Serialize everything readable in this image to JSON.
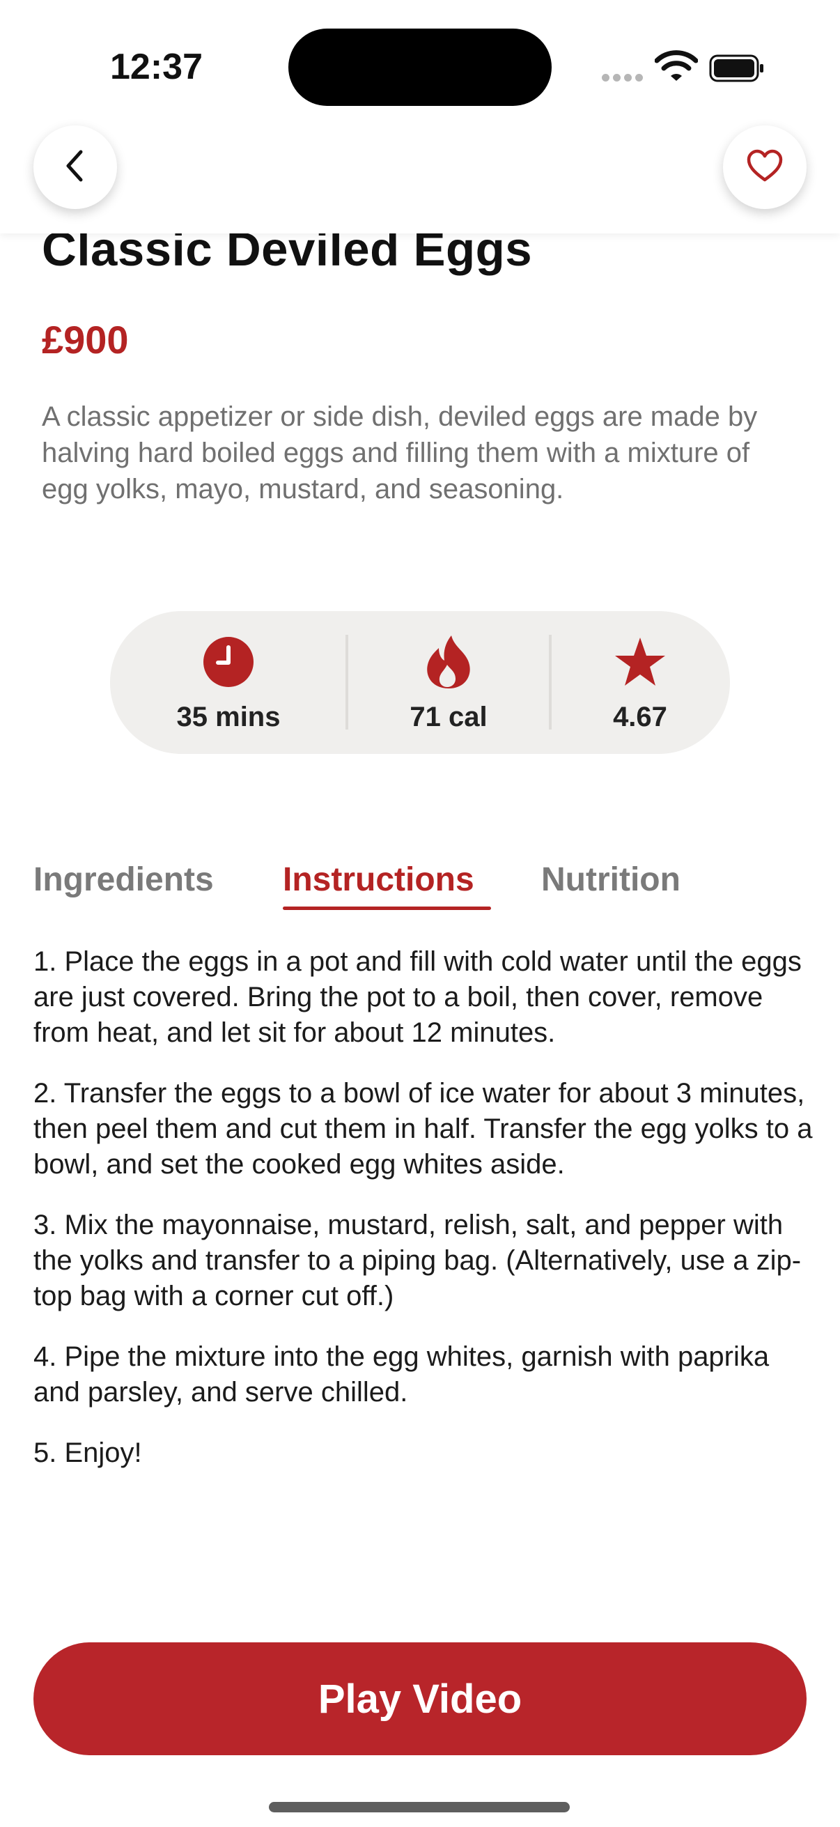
{
  "status_bar": {
    "time": "12:37"
  },
  "recipe": {
    "title": "Classic Deviled Eggs",
    "price": "£900",
    "description": "A classic appetizer or side dish, deviled eggs are made by halving hard boiled eggs and filling them with a mixture of egg yolks, mayo, mustard, and seasoning.",
    "stats": {
      "time": "35 mins",
      "calories": "71 cal",
      "rating": "4.67"
    }
  },
  "tabs": [
    {
      "label": "Ingredients",
      "active": false
    },
    {
      "label": "Instructions",
      "active": true
    },
    {
      "label": "Nutrition",
      "active": false
    }
  ],
  "instructions": [
    "1. Place the eggs in a pot and fill with cold water until the eggs are just covered. Bring the pot to a boil, then cover, remove from heat, and let sit for about 12 minutes.",
    "2. Transfer the eggs to a bowl of ice water for about 3 minutes, then peel them and cut them in half. Transfer the egg yolks to a bowl, and set the cooked egg whites aside.",
    "3. Mix the mayonnaise, mustard, relish, salt, and pepper with the yolks and transfer to a piping bag. (Alternatively, use a zip-top bag with a corner cut off.)",
    "4. Pipe the mixture into the egg whites, garnish with paprika and parsley, and serve chilled.",
    "5. Enjoy!"
  ],
  "actions": {
    "play_video": "Play Video"
  },
  "icons": {
    "back": "chevron-left-icon",
    "favorite": "heart-outline-icon",
    "time": "clock-icon",
    "calories": "flame-icon",
    "rating": "star-icon"
  },
  "colors": {
    "accent": "#b42323",
    "button": "#b8252a",
    "stats_bg": "#f0efed"
  }
}
